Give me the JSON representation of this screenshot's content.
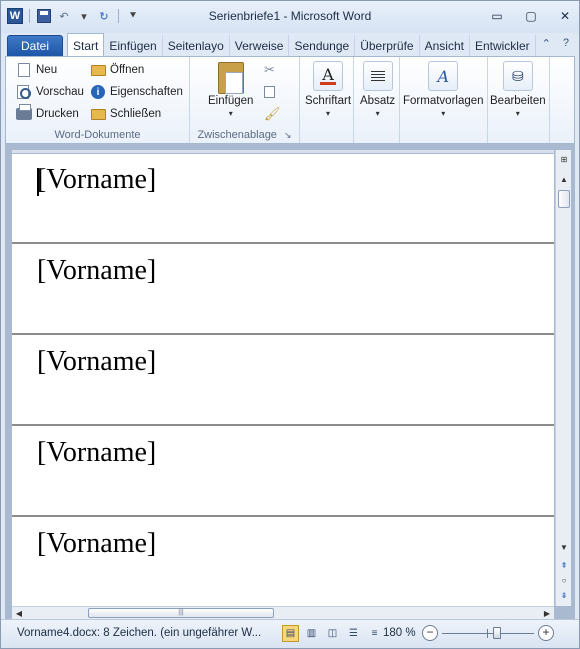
{
  "window": {
    "title": "Serienbriefe1 - Microsoft Word",
    "minimize_glyph": "▭",
    "maximize_glyph": "▢",
    "close_glyph": "✕"
  },
  "quick_access": {
    "app_icon_letter": "W",
    "undo_glyph": "↶",
    "redo_glyph": "↻",
    "dropdown_glyph": "▾",
    "customize_glyph": "⯆"
  },
  "tabs": [
    {
      "label": "Datei"
    },
    {
      "label": "Start"
    },
    {
      "label": "Einfügen"
    },
    {
      "label": "Seitenlayo"
    },
    {
      "label": "Verweise"
    },
    {
      "label": "Sendunge"
    },
    {
      "label": "Überprüfe"
    },
    {
      "label": "Ansicht"
    },
    {
      "label": "Entwickler"
    }
  ],
  "tabs_right": {
    "collapse_glyph": "⌃",
    "help_glyph": "?"
  },
  "ribbon": {
    "word_docs": {
      "label": "Word-Dokumente",
      "new_label": "Neu",
      "open_label": "Öffnen",
      "preview_label": "Vorschau",
      "properties_label": "Eigenschaften",
      "print_label": "Drucken",
      "close_label": "Schließen"
    },
    "clipboard": {
      "label": "Zwischenablage",
      "paste_label": "Einfügen",
      "launcher_glyph": "↘"
    },
    "font": {
      "label": "Schriftart",
      "glyph": "A"
    },
    "paragraph": {
      "label": "Absatz"
    },
    "styles": {
      "label": "Formatvorlagen",
      "glyph": "A"
    },
    "editing": {
      "label": "Bearbeiten",
      "glyph": "⛁"
    }
  },
  "document": {
    "records": [
      {
        "text": "[Vorname]"
      },
      {
        "text": "[Vorname]"
      },
      {
        "text": "[Vorname]"
      },
      {
        "text": "[Vorname]"
      },
      {
        "text": "[Vorname]"
      }
    ]
  },
  "scroll": {
    "up_glyph": "▲",
    "down_glyph": "▼",
    "left_glyph": "◀",
    "right_glyph": "▶",
    "prev_page_glyph": "⇞",
    "browse_glyph": "○",
    "next_page_glyph": "⇟",
    "thumb_grip": "|||"
  },
  "statusbar": {
    "text": "Vorname4.docx: 8 Zeichen. (ein ungefährer W...",
    "zoom_level": "180 %",
    "zoom_out_glyph": "−",
    "zoom_in_glyph": "+",
    "zoom_fraction": 0.6
  }
}
